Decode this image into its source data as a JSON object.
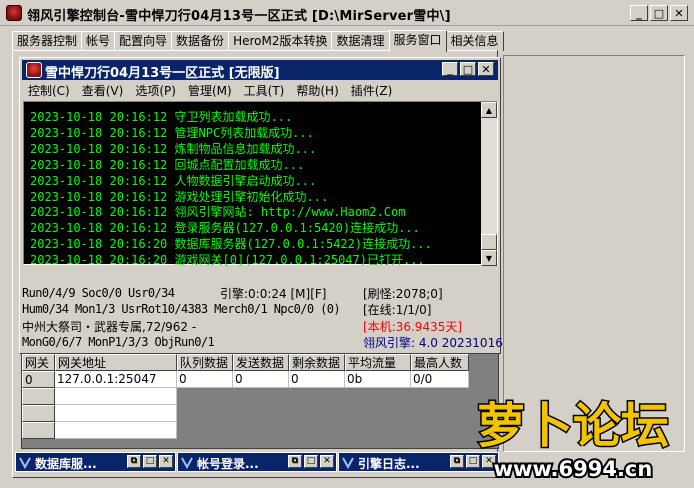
{
  "window": {
    "title": "翎风引擎控制台-雪中悍刀行04月13号一区正式 [D:\\MirServer雪中\\]",
    "caption_min": "_",
    "caption_max": "□",
    "caption_close": "✕"
  },
  "tabs": [
    {
      "label": "服务器控制"
    },
    {
      "label": "帐号"
    },
    {
      "label": "配置向导"
    },
    {
      "label": "数据备份"
    },
    {
      "label": "HeroM2版本转换"
    },
    {
      "label": "数据清理"
    },
    {
      "label": "服务窗口",
      "active": true
    },
    {
      "label": "相关信息"
    }
  ],
  "inner_window": {
    "title": "雪中悍刀行04月13号一区正式 [无限版]",
    "caption_min": "_",
    "caption_max": "□",
    "caption_close": "✕"
  },
  "menu": [
    {
      "label": "控制(C)"
    },
    {
      "label": "查看(V)"
    },
    {
      "label": "选项(P)"
    },
    {
      "label": "管理(M)"
    },
    {
      "label": "工具(T)"
    },
    {
      "label": "帮助(H)"
    },
    {
      "label": "插件(Z)"
    }
  ],
  "log": {
    "lines": [
      "2023-10-18 20:16:12 守卫列表加载成功...",
      "2023-10-18 20:16:12 管理NPC列表加载成功...",
      "2023-10-18 20:16:12 炼制物品信息加载成功...",
      "2023-10-18 20:16:12 回城点配置加载成功...",
      "2023-10-18 20:16:12 人物数据引擎启动成功...",
      "2023-10-18 20:16:12 游戏处理引擎初始化成功...",
      "2023-10-18 20:16:12 翎风引擎网站: http://www.Haom2.Com",
      "2023-10-18 20:16:12 登录服务器(127.0.0.1:5420)连接成功...",
      "2023-10-18 20:16:20 数据库服务器(127.0.0.1:5422)连接成功...",
      "2023-10-18 20:16:20 游戏网关[0](127.0.0.1:25047)已打开..."
    ],
    "text_color": "#00ff00",
    "scroll_up": "▲",
    "scroll_down": "▼"
  },
  "stats": {
    "run": "Run0/4/9 Soc0/0 Usr0/34",
    "engine": "引擎:0:0:24 [M][F]",
    "refresh": "[刷怪:2078;0]",
    "hum": "Hum0/34 Mon1/3 UsrRot10/4383 Merch0/1 Npc0/0 (0)",
    "online": "[在线:1/1/0]",
    "map": "中州大祭司・武器专属,72/962 -",
    "local": "[本机:36.9435天]",
    "mon": "MonG0/6/7 MonP1/3/3 ObjRun0/1",
    "version": "翎风引擎: 4.0 20231016",
    "local_color": "#ff0000",
    "version_color": "#000080"
  },
  "grid": {
    "headers": [
      "网关",
      "网关地址",
      "队列数据",
      "发送数据",
      "剩余数据",
      "平均流量",
      "最高人数"
    ],
    "rows": [
      [
        "0",
        "127.0.0.1:25047",
        "0",
        "0",
        "0",
        "0b",
        "0/0"
      ]
    ]
  },
  "minimized": [
    {
      "title": "数据库服..."
    },
    {
      "title": "帐号登录..."
    },
    {
      "title": "引擎日志..."
    }
  ],
  "watermark": {
    "title": "萝卜论坛",
    "url": "www.6994.cn",
    "color": "#f2c400"
  }
}
